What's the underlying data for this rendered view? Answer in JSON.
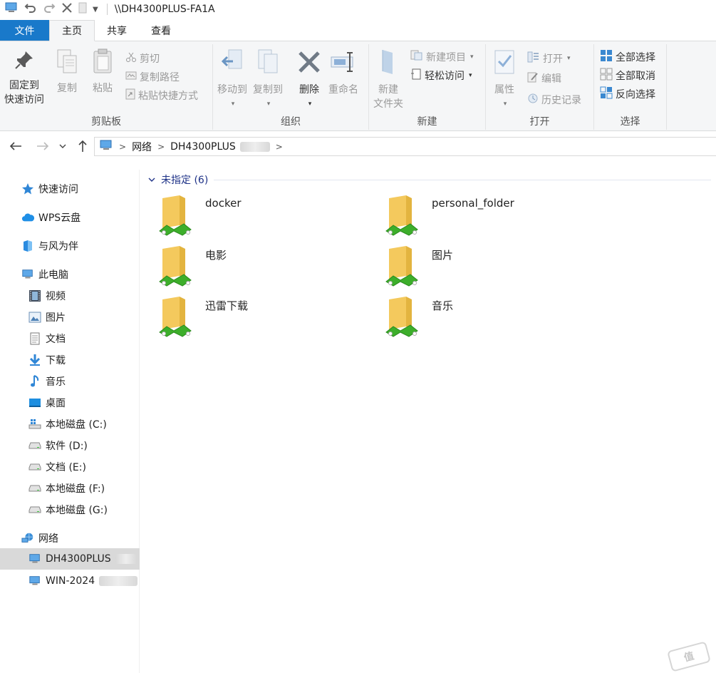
{
  "window": {
    "title": "\\\\DH4300PLUS-FA1A"
  },
  "tabs": [
    {
      "label": "文件"
    },
    {
      "label": "主页"
    },
    {
      "label": "共享"
    },
    {
      "label": "查看"
    }
  ],
  "ribbon": {
    "clipboard": {
      "label": "剪贴板",
      "pin_l1": "固定到",
      "pin_l2": "快速访问",
      "copy": "复制",
      "paste": "粘贴",
      "cut": "剪切",
      "copy_path": "复制路径",
      "paste_shortcut": "粘贴快捷方式"
    },
    "organize": {
      "label": "组织",
      "move_to": "移动到",
      "copy_to": "复制到",
      "delete": "删除",
      "rename": "重命名"
    },
    "new": {
      "label": "新建",
      "new_folder_l1": "新建",
      "new_folder_l2": "文件夹",
      "new_item": "新建项目",
      "easy_access": "轻松访问"
    },
    "open": {
      "label": "打开",
      "properties": "属性",
      "open": "打开",
      "edit": "编辑",
      "history": "历史记录"
    },
    "select": {
      "label": "选择",
      "select_all": "全部选择",
      "select_none": "全部取消",
      "invert": "反向选择"
    }
  },
  "address": {
    "crumbs": [
      "网络",
      "DH4300PLUS"
    ]
  },
  "sidebar": {
    "items": [
      {
        "label": "快速访问"
      },
      {
        "label": "WPS云盘"
      },
      {
        "label": "与风为伴"
      },
      {
        "label": "此电脑"
      },
      {
        "label": "视频"
      },
      {
        "label": "图片"
      },
      {
        "label": "文档"
      },
      {
        "label": "下载"
      },
      {
        "label": "音乐"
      },
      {
        "label": "桌面"
      },
      {
        "label": "本地磁盘 (C:)"
      },
      {
        "label": "软件 (D:)"
      },
      {
        "label": "文档 (E:)"
      },
      {
        "label": "本地磁盘 (F:)"
      },
      {
        "label": "本地磁盘 (G:)"
      },
      {
        "label": "网络"
      },
      {
        "label": "DH4300PLUS"
      },
      {
        "label": "WIN-2024"
      }
    ]
  },
  "content": {
    "group_title": "未指定 (6)",
    "folders": [
      {
        "name": "docker"
      },
      {
        "name": "personal_folder"
      },
      {
        "name": "电影"
      },
      {
        "name": "图片"
      },
      {
        "name": "迅雷下载"
      },
      {
        "name": "音乐"
      }
    ]
  },
  "colors": {
    "accent": "#1979ca",
    "folder": "#f4c95d",
    "share": "#3dae2b"
  }
}
